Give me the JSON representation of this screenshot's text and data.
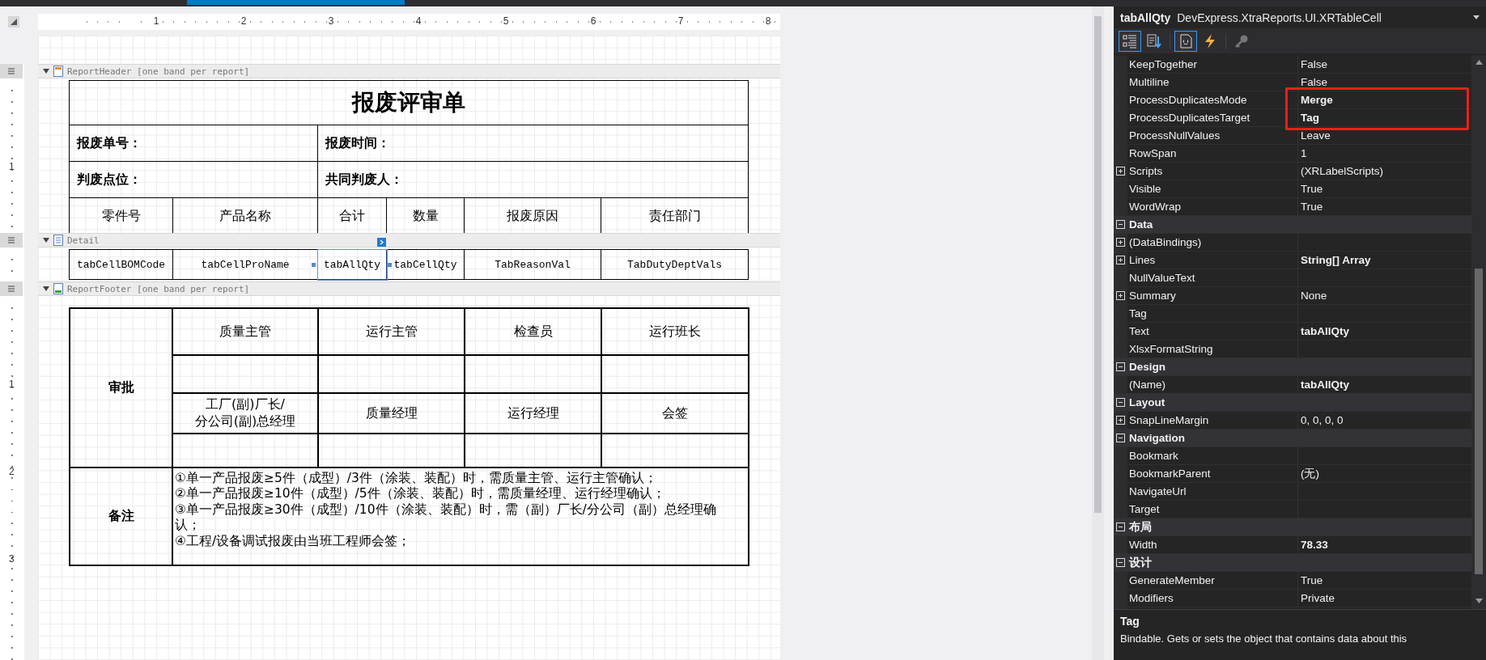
{
  "designer": {
    "ruler_numbers": [
      "1",
      "2",
      "3",
      "4",
      "5",
      "6",
      "7",
      "8"
    ],
    "bands": [
      {
        "kind": "header",
        "caption": "ReportHeader [one band per report]",
        "expanded": true,
        "ruler_numbers": [
          "1"
        ]
      },
      {
        "kind": "detail",
        "caption": "Detail",
        "expanded": true
      },
      {
        "kind": "footer",
        "caption": "ReportFooter [one band per report]",
        "expanded": true,
        "ruler_numbers": [
          "1",
          "2",
          "3"
        ]
      }
    ],
    "report_header": {
      "title": "报废评审单",
      "info_rows": [
        [
          "报废单号：",
          "报废时间："
        ],
        [
          "判废点位：",
          "共同判废人："
        ]
      ],
      "columns": [
        "零件号",
        "产品名称",
        "合计",
        "数量",
        "报废原因",
        "责任部门"
      ]
    },
    "detail": {
      "cells": [
        {
          "text": "tabCellBOMCode",
          "selected": false
        },
        {
          "text": "tabCellProName",
          "selected": false
        },
        {
          "text": "tabAllQty",
          "selected": true
        },
        {
          "text": "tabCellQty",
          "selected": false
        },
        {
          "text": "TabReasonVal",
          "selected": false
        },
        {
          "text": "TabDutyDeptVals",
          "selected": false
        }
      ]
    },
    "report_footer": {
      "approval_label": "审批",
      "approval_rows": [
        {
          "kind": "labels",
          "cells": [
            "质量主管",
            "运行主管",
            "检查员",
            "运行班长"
          ]
        },
        {
          "kind": "blank"
        },
        {
          "kind": "labels",
          "cells": [
            "工厂(副)厂长/\n分公司(副)总经理",
            "质量经理",
            "运行经理",
            "会签"
          ]
        },
        {
          "kind": "blank"
        }
      ],
      "remarks_label": "备注",
      "remarks": [
        "①单一产品报废≥5件（成型）/3件（涂装、装配）时，需质量主管、运行主管确认；",
        "②单一产品报废≥10件（成型）/5件（涂装、装配）时，需质量经理、运行经理确认；",
        "③单一产品报废≥30件（成型）/10件（涂装、装配）时，需（副）厂长/分公司（副）总经理确认；",
        "④工程/设备调试报废由当班工程师会签；"
      ]
    }
  },
  "properties": {
    "object_name": "tabAllQty",
    "object_type": "DevExpress.XtraReports.UI.XRTableCell",
    "toolbar": [
      {
        "kind": "categorized",
        "selected": true
      },
      {
        "kind": "alphabetical",
        "selected": false
      },
      {
        "kind": "properties",
        "selected": true
      },
      {
        "kind": "events",
        "selected": false
      },
      {
        "kind": "key",
        "selected": false
      }
    ],
    "rows": [
      {
        "kind": "property",
        "name": "KeepTogether",
        "value": "False",
        "modified": false,
        "expandable": false,
        "highlighted": false
      },
      {
        "kind": "property",
        "name": "Multiline",
        "value": "False",
        "modified": false,
        "expandable": false,
        "highlighted": false
      },
      {
        "kind": "property",
        "name": "ProcessDuplicatesMode",
        "value": "Merge",
        "modified": true,
        "expandable": false,
        "highlighted": true
      },
      {
        "kind": "property",
        "name": "ProcessDuplicatesTarget",
        "value": "Tag",
        "modified": true,
        "expandable": false,
        "highlighted": true
      },
      {
        "kind": "property",
        "name": "ProcessNullValues",
        "value": "Leave",
        "modified": false,
        "expandable": false,
        "highlighted": false
      },
      {
        "kind": "property",
        "name": "RowSpan",
        "value": "1",
        "modified": false,
        "expandable": false,
        "highlighted": false
      },
      {
        "kind": "property",
        "name": "Scripts",
        "value": "(XRLabelScripts)",
        "modified": false,
        "expandable": true,
        "highlighted": false
      },
      {
        "kind": "property",
        "name": "Visible",
        "value": "True",
        "modified": false,
        "expandable": false,
        "highlighted": false
      },
      {
        "kind": "property",
        "name": "WordWrap",
        "value": "True",
        "modified": false,
        "expandable": false,
        "highlighted": false
      },
      {
        "kind": "category",
        "name": "Data",
        "expanded": true
      },
      {
        "kind": "property",
        "name": "(DataBindings)",
        "expandable": true,
        "highlighted": false
      },
      {
        "kind": "property",
        "name": "Lines",
        "value": "String[] Array",
        "modified": true,
        "expandable": true,
        "highlighted": false
      },
      {
        "kind": "property",
        "name": "NullValueText",
        "expandable": false,
        "highlighted": false
      },
      {
        "kind": "property",
        "name": "Summary",
        "value": "None",
        "modified": false,
        "expandable": true,
        "highlighted": false
      },
      {
        "kind": "property",
        "name": "Tag",
        "expandable": false,
        "highlighted": false
      },
      {
        "kind": "property",
        "name": "Text",
        "value": "tabAllQty",
        "modified": true,
        "expandable": false,
        "highlighted": false
      },
      {
        "kind": "property",
        "name": "XlsxFormatString",
        "expandable": false,
        "highlighted": false
      },
      {
        "kind": "category",
        "name": "Design",
        "expanded": true
      },
      {
        "kind": "property",
        "name": "(Name)",
        "value": "tabAllQty",
        "modified": true,
        "expandable": false,
        "highlighted": false
      },
      {
        "kind": "category",
        "name": "Layout",
        "expanded": true
      },
      {
        "kind": "property",
        "name": "SnapLineMargin",
        "value": "0, 0, 0, 0",
        "modified": false,
        "expandable": true,
        "highlighted": false
      },
      {
        "kind": "category",
        "name": "Navigation",
        "expanded": true
      },
      {
        "kind": "property",
        "name": "Bookmark",
        "expandable": false,
        "highlighted": false
      },
      {
        "kind": "property",
        "name": "BookmarkParent",
        "value": "(无)",
        "modified": false,
        "expandable": false,
        "highlighted": false
      },
      {
        "kind": "property",
        "name": "NavigateUrl",
        "expandable": false,
        "highlighted": false
      },
      {
        "kind": "property",
        "name": "Target",
        "expandable": false,
        "highlighted": false
      },
      {
        "kind": "category",
        "name": "布局",
        "expanded": true
      },
      {
        "kind": "property",
        "name": "Width",
        "value": "78.33",
        "modified": true,
        "expandable": false,
        "highlighted": false
      },
      {
        "kind": "category",
        "name": "设计",
        "expanded": true
      },
      {
        "kind": "property",
        "name": "GenerateMember",
        "value": "True",
        "modified": false,
        "expandable": false,
        "highlighted": false
      },
      {
        "kind": "property",
        "name": "Modifiers",
        "value": "Private",
        "modified": false,
        "expandable": false,
        "highlighted": false
      }
    ],
    "description": {
      "title": "Tag",
      "text": "Bindable. Gets or sets the object that contains data about this"
    }
  }
}
